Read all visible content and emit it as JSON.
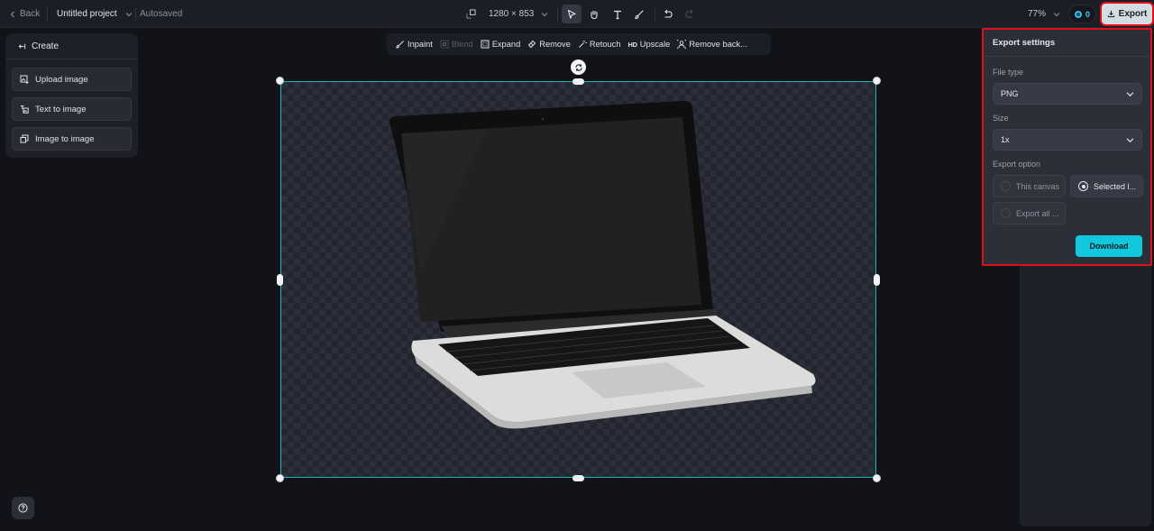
{
  "topbar": {
    "back_label": "Back",
    "project_name": "Untitled project",
    "save_status": "Autosaved",
    "canvas_size": "1280 × 853",
    "zoom_level": "77%",
    "credits": "0",
    "export_label": "Export",
    "tools": [
      {
        "name": "select",
        "icon": "cursor-icon",
        "active": true
      },
      {
        "name": "hand",
        "icon": "hand-icon",
        "active": false
      },
      {
        "name": "text",
        "icon": "text-icon",
        "active": false
      },
      {
        "name": "brush",
        "icon": "brush-icon",
        "active": false
      }
    ],
    "undo_icon": "undo-icon",
    "redo_icon": "redo-icon"
  },
  "create_panel": {
    "title": "Create",
    "items": [
      {
        "label": "Upload image",
        "icon": "upload-image-icon"
      },
      {
        "label": "Text to image",
        "icon": "text-to-image-icon"
      },
      {
        "label": "Image to image",
        "icon": "image-to-image-icon"
      }
    ]
  },
  "image_toolbar": {
    "items": [
      {
        "label": "Inpaint",
        "icon": "inpaint-icon",
        "disabled": false
      },
      {
        "label": "Blend",
        "icon": "blend-icon",
        "disabled": true
      },
      {
        "label": "Expand",
        "icon": "expand-icon",
        "disabled": false
      },
      {
        "label": "Remove",
        "icon": "eraser-icon",
        "disabled": false
      },
      {
        "label": "Retouch",
        "icon": "magic-wand-icon",
        "disabled": false
      },
      {
        "label": "Upscale",
        "icon_text": "HD",
        "disabled": false
      },
      {
        "label": "Remove back...",
        "icon": "remove-background-icon",
        "disabled": false
      }
    ]
  },
  "canvas": {
    "content": "Laptop image on transparent background"
  },
  "export_settings": {
    "title": "Export settings",
    "file_type_label": "File type",
    "file_type_value": "PNG",
    "size_label": "Size",
    "size_value": "1x",
    "export_option_label": "Export option",
    "options": [
      {
        "label": "This canvas",
        "selected": false
      },
      {
        "label": "Selected l...",
        "selected": true
      },
      {
        "label": "Export all ...",
        "selected": false
      }
    ],
    "download_label": "Download"
  },
  "colors": {
    "accent": "#12c8dc",
    "selection": "#1fb6b8",
    "highlight_outline": "#e0101b"
  }
}
